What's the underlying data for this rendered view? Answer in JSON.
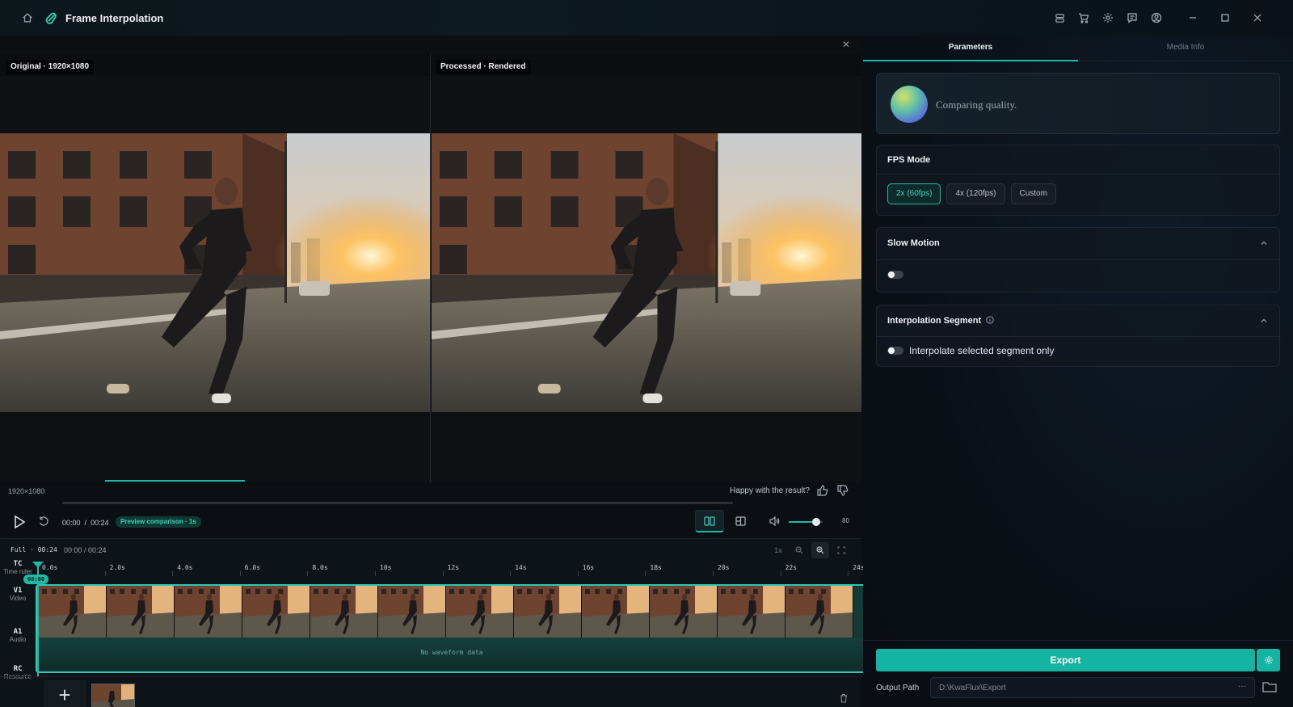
{
  "app": {
    "title": "Frame Interpolation"
  },
  "preview": {
    "left_label": "Original · 1920×1080",
    "right_label": "Processed · Rendered",
    "resolution": "1920×1080",
    "feedback_prompt": "Happy with the result?"
  },
  "player": {
    "current_time": "00:00",
    "separator": "/",
    "total_time": "00:24",
    "badge": "Preview comparison · 1s",
    "volume": 80,
    "volume_label": "80"
  },
  "timeline": {
    "mode": "Full",
    "mode_duration": "00:24",
    "range": "00:00 / 00:24",
    "zoom_label": "1x",
    "playhead_label": "00:00",
    "tracks": [
      {
        "code": "TC",
        "name": "Time ruler"
      },
      {
        "code": "V1",
        "name": "Video"
      },
      {
        "code": "A1",
        "name": "Audio"
      },
      {
        "code": "RC",
        "name": "Resource"
      }
    ],
    "ticks": [
      "0.0s",
      "2.0s",
      "4.0s",
      "6.0s",
      "8.0s",
      "10s",
      "12s",
      "14s",
      "16s",
      "18s",
      "20s",
      "22s",
      "24s"
    ],
    "audio_placeholder": "No waveform data"
  },
  "panel": {
    "tabs": [
      {
        "label": "Parameters",
        "active": true
      },
      {
        "label": "Media Info",
        "active": false
      }
    ],
    "quality_text": "Comparing quality.",
    "fps_mode": {
      "title": "FPS Mode",
      "options": [
        "2x (60fps)",
        "4x (120fps)",
        "Custom"
      ],
      "selected": "2x (60fps)"
    },
    "slow_motion": {
      "title": "Slow Motion",
      "enabled": false
    },
    "interpolation_segment": {
      "title": "Interpolation Segment",
      "toggle_label": "Interpolate selected segment only",
      "enabled": false
    },
    "export_label": "Export",
    "output_path_label": "Output Path",
    "output_path_value": "D:\\KwaFlux\\Export",
    "output_more": "···"
  },
  "colors": {
    "accent": "#1fb7a6",
    "background": "#0b0f14",
    "panel": "#0b1017"
  },
  "icons": {
    "home": "home-icon",
    "logo": "logo-icon",
    "toolbar": [
      "storage-icon",
      "cart-icon",
      "settings-icon",
      "message-icon",
      "account-icon"
    ],
    "window": [
      "minimize-icon",
      "maximize-icon",
      "close-icon"
    ]
  }
}
